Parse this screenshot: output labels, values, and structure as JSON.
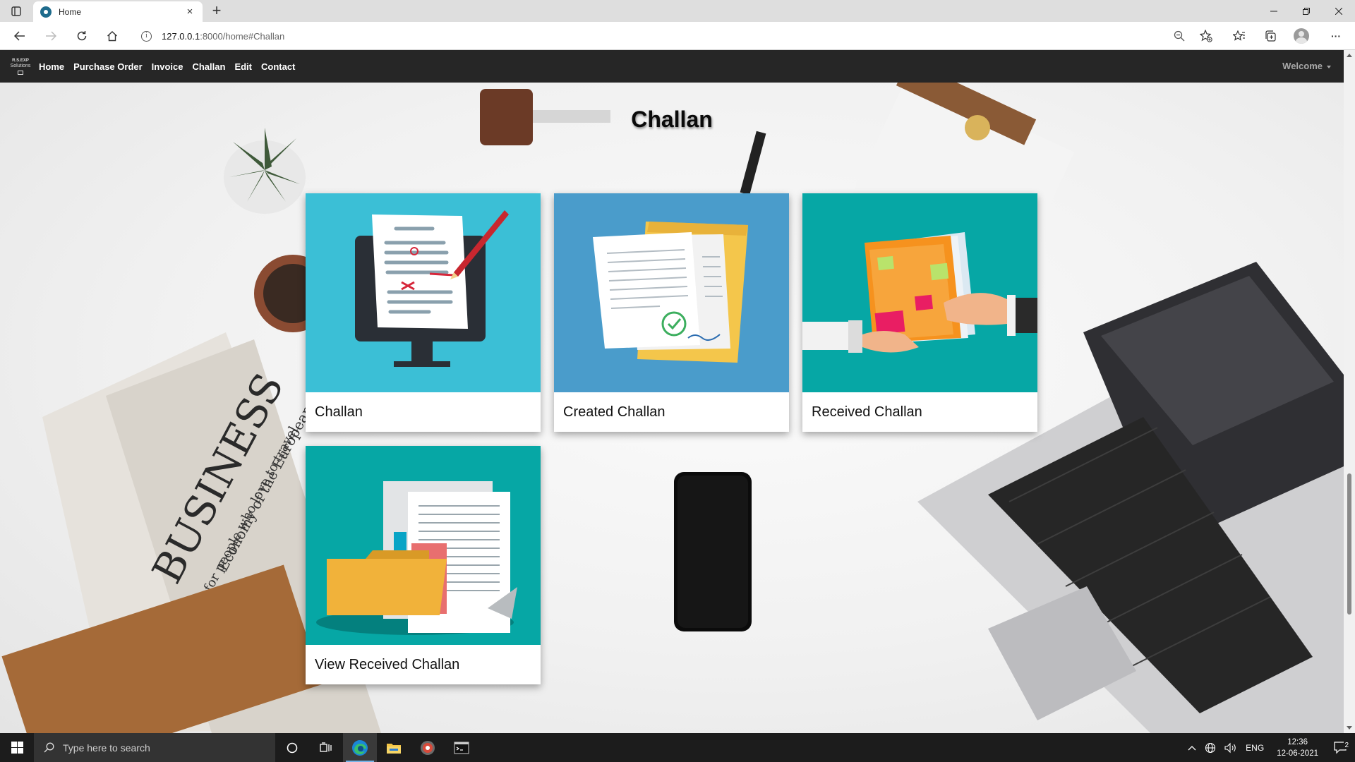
{
  "browser": {
    "tab_title": "Home",
    "tab_close": "×",
    "new_tab": "+",
    "url_host": "127.0.0.1",
    "url_rest": ":8000/home#Challan"
  },
  "navbar": {
    "logo_line1": "R.S.EXP",
    "logo_line2": "Solutions",
    "links": [
      "Home",
      "Purchase Order",
      "Invoice",
      "Challan",
      "Edit",
      "Contact"
    ],
    "welcome": "Welcome"
  },
  "page": {
    "title": "Challan",
    "cards": [
      {
        "label": "Challan",
        "image": "computer-document-illustration",
        "bg": "#3bbfd6"
      },
      {
        "label": "Created Challan",
        "image": "approved-documents-illustration",
        "bg": "#4a9ccb"
      },
      {
        "label": "Received Challan",
        "image": "folder-handover-illustration",
        "bg": "#06a7a5"
      },
      {
        "label": "View Received Challan",
        "image": "folder-files-illustration",
        "bg": "#06a7a5"
      }
    ]
  },
  "taskbar": {
    "search_placeholder": "Type here to search",
    "language": "ENG",
    "time": "12:36",
    "date": "12-06-2021",
    "notification_count": "2"
  },
  "colors": {
    "navbar_bg": "#262626",
    "taskbar_bg": "#1c1c1c",
    "accent": "#77b4e8"
  }
}
